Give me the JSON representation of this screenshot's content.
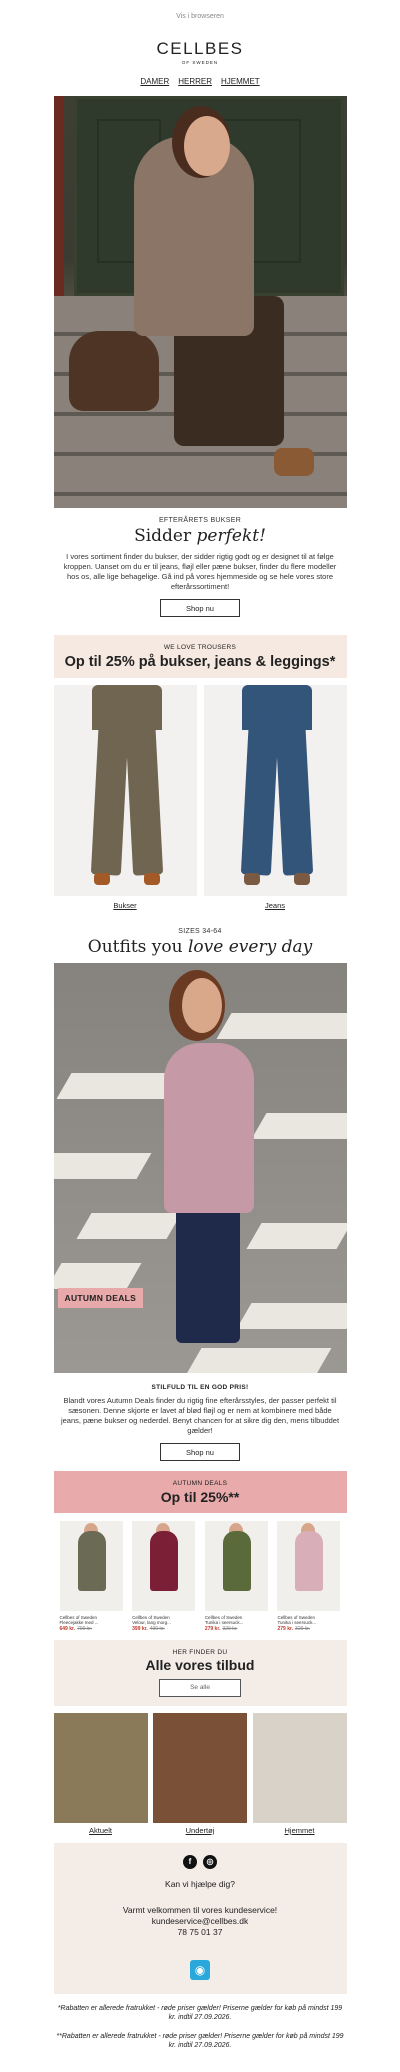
{
  "top_link": "Vis i browseren",
  "logo": {
    "name": "CELLBES",
    "sub": "OF SWEDEN"
  },
  "nav": [
    "DAMER",
    "HERRER",
    "HJEMMET"
  ],
  "section1": {
    "kicker": "EFTERÅRETS BUKSER",
    "title_plain": "Sidder ",
    "title_italic": "perfekt!",
    "text": "I vores sortiment finder du bukser, der sidder rigtig godt og er designet til at følge kroppen. Uanset om du er til jeans, fløjl eller pæne bukser, finder du flere modeller hos os, alle lige behagelige. Gå ind på vores hjemmeside og se hele vores store efterårssortiment!",
    "button": "Shop nu"
  },
  "promo1": {
    "kicker": "WE LOVE TROUSERS",
    "title": "Op til 25% på bukser, jeans & leggings*"
  },
  "products2": [
    {
      "caption": "Bukser",
      "color": "#6f6550",
      "shoe": "#a35a26"
    },
    {
      "caption": "Jeans",
      "color": "#33557a",
      "shoe": "#7a5a43"
    }
  ],
  "section2": {
    "kicker": "SIZES 34-64",
    "title_plain": "Outfits you ",
    "title_italic": "love every day",
    "tag": "AUTUMN DEALS",
    "sub": "STILFULD TIL EN GOD PRIS!",
    "text": "Blandt vores Autumn Deals finder du rigtig fine efterårsstyles, der passer perfekt til sæsonen. Denne skjorte er lavet af blød fløjl og er nem at kombinere med både jeans, pæne bukser og nederdel. Benyt chancen for at sikre dig den, mens tilbuddet gælder!",
    "button": "Shop nu"
  },
  "promo2": {
    "kicker": "AUTUMN DEALS",
    "title": "Op til 25%**"
  },
  "products4": [
    {
      "brand": "Cellbes of Sweden",
      "name": "Fleecejakke med ...",
      "price": "649 kr.",
      "old": "799 kr.",
      "color": "#6b6a55"
    },
    {
      "brand": "Cellbes of Sweden",
      "name": "Velour, lang morg...",
      "price": "399 kr.",
      "old": "499 kr.",
      "color": "#7a1f35"
    },
    {
      "brand": "Cellbes of Sweden",
      "name": "Tunika i seersuck...",
      "price": "279 kr.",
      "old": "329 kr.",
      "color": "#5a6a3a"
    },
    {
      "brand": "Cellbes of Sweden",
      "name": "Tunika i seersuck...",
      "price": "279 kr.",
      "old": "329 kr.",
      "color": "#d8aeb9"
    }
  ],
  "offers": {
    "kicker": "HER FINDER DU",
    "title": "Alle vores tilbud",
    "button": "Se alle"
  },
  "categories": [
    {
      "caption": "Aktuelt",
      "bg": "#8a7a5a"
    },
    {
      "caption": "Undertøj",
      "bg": "#7a5036"
    },
    {
      "caption": "Hjemmet",
      "bg": "#d9d2c8"
    }
  ],
  "footer": {
    "social": [
      "f",
      "◎"
    ],
    "question": "Kan vi hjælpe dig?",
    "welcome": "Varmt velkommen til vores kundeservice!",
    "email": "kundeservice@cellbes.dk",
    "phone": "78 75 01 37"
  },
  "fine1": "*Rabatten er allerede fratrukket - røde priser gælder! Priserne gælder for køb på mindst 199 kr. indtil 27.09.2026.",
  "fine2": "**Rabatten er allerede fratrukket - røde priser gælder! Priserne gælder for køb på mindst 199 kr. indtil 27.09.2026."
}
